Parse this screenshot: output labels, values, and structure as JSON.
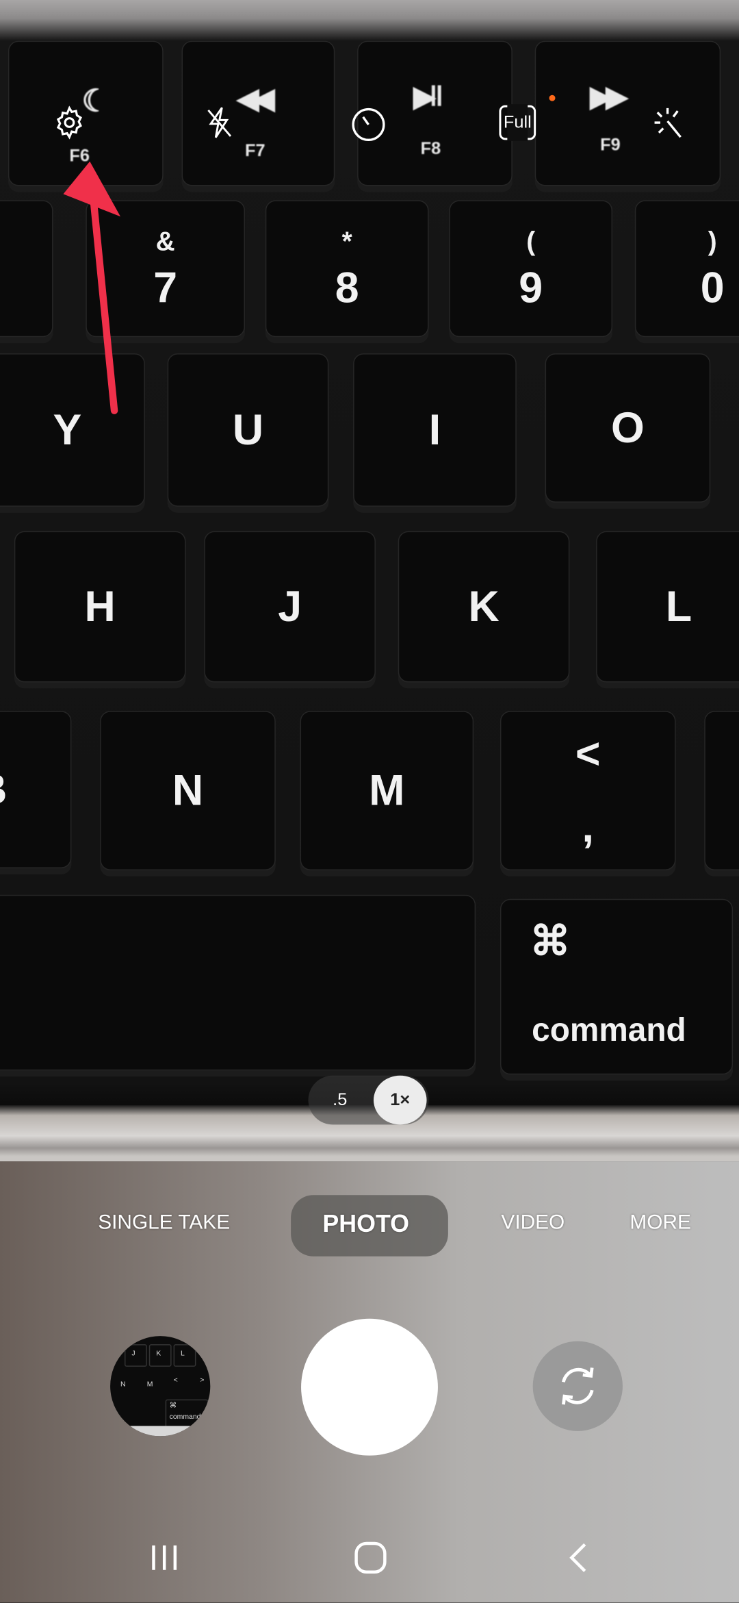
{
  "preview": {
    "number_row": [
      {
        "top": "&",
        "bottom": "7"
      },
      {
        "top": "*",
        "bottom": "8"
      },
      {
        "top": "(",
        "bottom": "9"
      },
      {
        "top": ")",
        "bottom": "0"
      }
    ],
    "row_yuio": [
      "Y",
      "U",
      "I",
      "O"
    ],
    "row_hjkl": [
      "H",
      "J",
      "K",
      "L"
    ],
    "row_nm": [
      "B",
      "N",
      "M"
    ],
    "comma_key": {
      "top": "<",
      "bottom": ","
    },
    "command_key": {
      "glyph": "⌘",
      "word": "command"
    },
    "function_keys": [
      "F6",
      "F7",
      "F8",
      "F9"
    ]
  },
  "top_bar": {
    "icons": [
      "settings-gear-icon",
      "flash-off-icon",
      "timer-icon",
      "aspect-ratio-full-icon",
      "filter-magic-wand-icon"
    ],
    "aspect_ratio_label": "Full",
    "indicator_dot_color": "#ff6a1a"
  },
  "annotation": {
    "arrow_color": "#f0304a",
    "target": "settings-gear-icon"
  },
  "zoom": {
    "options": [
      ".5",
      "1×"
    ],
    "selected": "1×"
  },
  "modes": {
    "items": [
      "SINGLE TAKE",
      "PHOTO",
      "VIDEO",
      "MORE"
    ],
    "selected": "PHOTO"
  },
  "gallery_thumb": {
    "keys": [
      "J",
      "K",
      "L",
      "N",
      "M",
      "<",
      ">",
      "⌘",
      "command"
    ]
  },
  "nav_bar": {
    "icons": [
      "recent-apps-icon",
      "home-icon",
      "back-icon"
    ]
  }
}
